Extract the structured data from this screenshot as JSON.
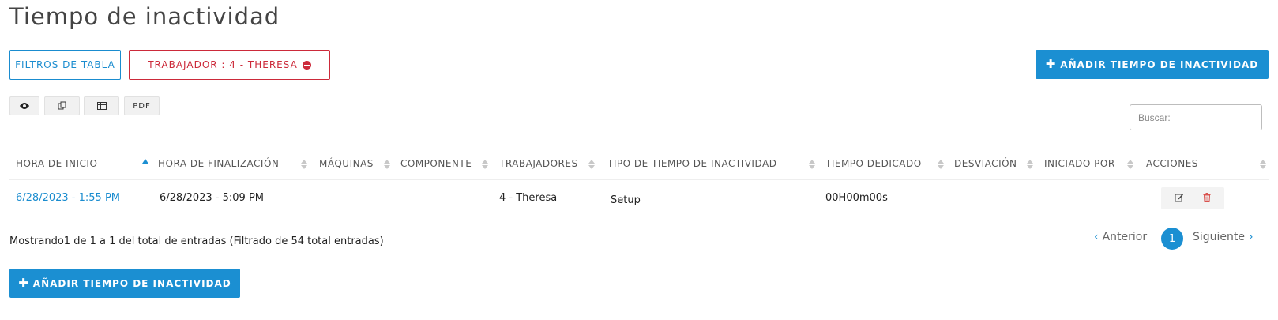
{
  "page": {
    "title": "Tiempo de inactividad"
  },
  "filters": {
    "table_filters_label": "FILTROS DE TABLA",
    "active_filter_label": "TRABAJADOR : 4 - THERESA"
  },
  "actions": {
    "add_label": "AÑADIR TIEMPO DE INACTIVIDAD"
  },
  "toolbar": {
    "pdf_label": "PDF"
  },
  "search": {
    "placeholder": "Buscar:"
  },
  "table": {
    "columns": [
      "HORA DE INICIO",
      "HORA DE FINALIZACIÓN",
      "MÁQUINAS",
      "COMPONENTE",
      "TRABAJADORES",
      "TIPO DE TIEMPO DE INACTIVIDAD",
      "TIEMPO DEDICADO",
      "DESVIACIÓN",
      "INICIADO POR",
      "ACCIONES"
    ],
    "rows": [
      {
        "start": "6/28/2023 - 1:55 PM",
        "end": "6/28/2023 - 5:09 PM",
        "machines": "",
        "component": "",
        "workers": "4 - Theresa",
        "downtime_type": "Setup",
        "time_spent": "00H00m00s",
        "deviation": "",
        "started_by": ""
      }
    ]
  },
  "info": {
    "text": "Mostrando1 de 1 a 1 del total de entradas (Filtrado de 54 total entradas)"
  },
  "pagination": {
    "prev_label": "Anterior",
    "current_page": "1",
    "next_label": "Siguiente"
  },
  "colors": {
    "primary": "#1b8fd2",
    "danger": "#cc2a3a"
  }
}
